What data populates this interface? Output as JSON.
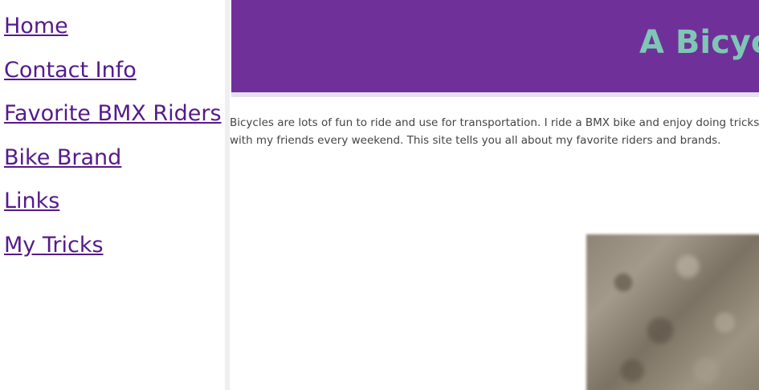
{
  "sidebar": {
    "items": [
      {
        "label": "Home"
      },
      {
        "label": "Contact Info"
      },
      {
        "label": "Favorite BMX Riders"
      },
      {
        "label": "Bike Brand"
      },
      {
        "label": "Links"
      },
      {
        "label": "My Tricks"
      }
    ]
  },
  "header": {
    "title": "A Bicycl"
  },
  "main": {
    "intro_lines": [
      "Bicycles are lots of fun to ride and use for transportation. I ride a BMX bike and enjoy doing tricks at the skate park",
      "with my friends every weekend. This site tells you all about my favorite riders and brands."
    ]
  },
  "colors": {
    "banner": "#70309a",
    "banner_title": "#7fc6b4",
    "link": "#551a8b"
  }
}
